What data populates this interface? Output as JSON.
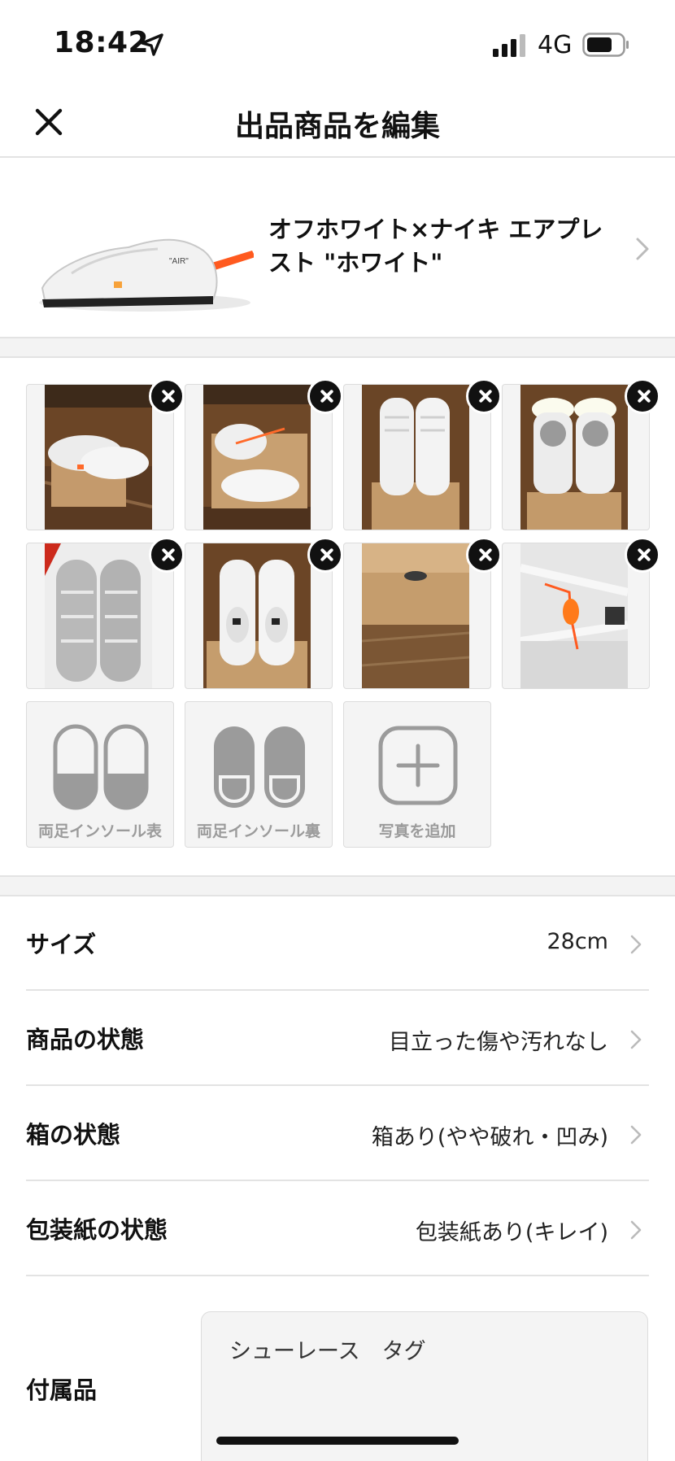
{
  "status_bar": {
    "time": "18:42",
    "network": "4G",
    "icons": [
      "location-arrow-icon",
      "signal-icon",
      "battery-icon"
    ]
  },
  "header": {
    "title": "出品商品を編集",
    "close_icon": "close-icon"
  },
  "product": {
    "name": "オフホワイト×ナイキ エアプレスト \"ホワイト\"",
    "chevron_icon": "chevron-right-icon"
  },
  "photos": {
    "count": 8,
    "delete_icon": "close-circle-icon"
  },
  "photo_slots": [
    {
      "label": "両足インソール表",
      "icon": "insole-top-icon"
    },
    {
      "label": "両足インソール裏",
      "icon": "insole-bottom-icon"
    },
    {
      "label": "写真を追加",
      "icon": "add-photo-icon"
    }
  ],
  "details": [
    {
      "label": "サイズ",
      "value": "28cm"
    },
    {
      "label": "商品の状態",
      "value": "目立った傷や汚れなし"
    },
    {
      "label": "箱の状態",
      "value": "箱あり(やや破れ・凹み)"
    },
    {
      "label": "包装紙の状態",
      "value": "包装紙あり(キレイ)"
    }
  ],
  "accessories": {
    "label": "付属品",
    "value": "シューレース　タグ"
  },
  "colors": {
    "text": "#111111",
    "divider": "#e3e3e3",
    "band": "#f3f3f3",
    "slot_text": "#9b9b9b",
    "tag_orange": "#ff5a1f"
  }
}
